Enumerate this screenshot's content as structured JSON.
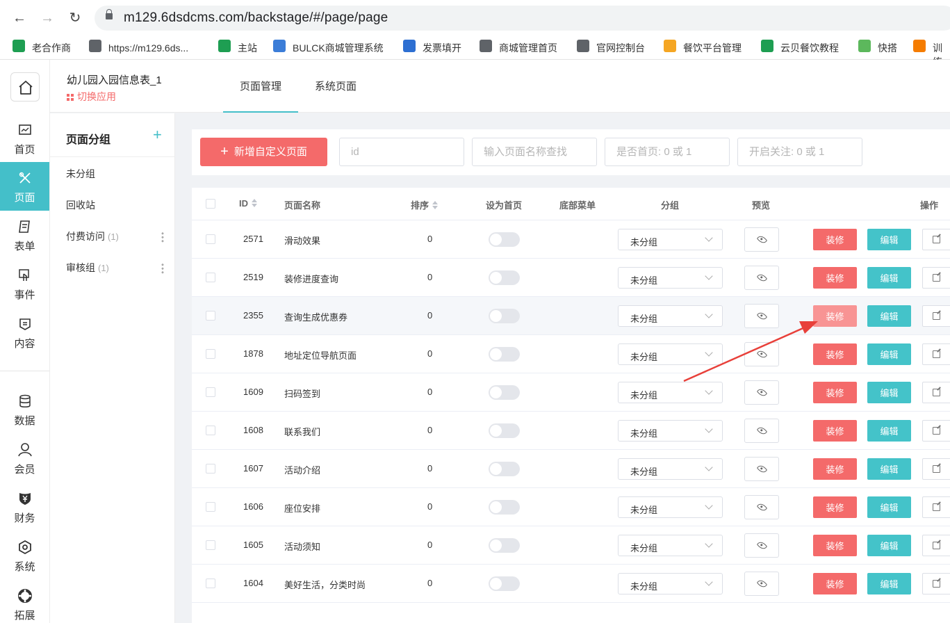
{
  "browser": {
    "url": "m129.6dsdcms.com/backstage/#/page/page",
    "bookmarks": [
      {
        "label": "老合作商",
        "icon_color": "#1e9e52"
      },
      {
        "label": "https://m129.6ds...",
        "icon_color": "#5f6368"
      },
      {
        "label": "主站",
        "icon_color": "#1e9e52"
      },
      {
        "label": "BULCK商城管理系统",
        "icon_color": "#3b7dd8"
      },
      {
        "label": "发票填开",
        "icon_color": "#2d6fd2"
      },
      {
        "label": "商城管理首页",
        "icon_color": "#5f6368"
      },
      {
        "label": "官网控制台",
        "icon_color": "#5f6368"
      },
      {
        "label": "餐饮平台管理",
        "icon_color": "#f5a623"
      },
      {
        "label": "云贝餐饮教程",
        "icon_color": "#1e9e52"
      },
      {
        "label": "快搭",
        "icon_color": "#5cb85c"
      },
      {
        "label": "训练",
        "icon_color": "#f57c00"
      }
    ]
  },
  "sidebar": {
    "items": [
      {
        "label": "首页",
        "icon": "chart-icon"
      },
      {
        "label": "页面",
        "icon": "design-tools-icon",
        "active": true
      },
      {
        "label": "表单",
        "icon": "form-icon"
      },
      {
        "label": "事件",
        "icon": "touch-icon"
      },
      {
        "label": "内容",
        "icon": "content-icon"
      },
      {
        "label": "数据",
        "icon": "database-icon"
      },
      {
        "label": "会员",
        "icon": "user-icon"
      },
      {
        "label": "财务",
        "icon": "yuan-icon"
      },
      {
        "label": "系统",
        "icon": "settings-icon"
      },
      {
        "label": "拓展",
        "icon": "extension-icon"
      }
    ]
  },
  "header": {
    "app_name": "幼儿园入园信息表_1",
    "switch_app": "切换应用",
    "tabs": [
      "页面管理",
      "系统页面"
    ]
  },
  "groups": {
    "title": "页面分组",
    "items": [
      {
        "label": "未分组",
        "count": ""
      },
      {
        "label": "回收站",
        "count": ""
      },
      {
        "label": "付费访问",
        "count": "(1)"
      },
      {
        "label": "审核组",
        "count": "(1)"
      }
    ]
  },
  "toolbar": {
    "add_label": "新增自定义页面",
    "id_placeholder": "id",
    "name_placeholder": "输入页面名称查找",
    "home_placeholder": "是否首页: 0 或 1",
    "follow_placeholder": "开启关注: 0 或 1"
  },
  "table": {
    "columns": {
      "id": "ID",
      "name": "页面名称",
      "sort": "排序",
      "homepage": "设为首页",
      "bottom_menu": "底部菜单",
      "group": "分组",
      "preview": "预览",
      "actions": "操作"
    },
    "decorate_label": "装修",
    "edit_label": "编辑",
    "rows": [
      {
        "id": "2571",
        "name": "滑动效果",
        "sort": "0",
        "group": "未分组"
      },
      {
        "id": "2519",
        "name": "装修进度查询",
        "sort": "0",
        "group": "未分组"
      },
      {
        "id": "2355",
        "name": "查询生成优惠券",
        "sort": "0",
        "group": "未分组"
      },
      {
        "id": "1878",
        "name": "地址定位导航页面",
        "sort": "0",
        "group": "未分组"
      },
      {
        "id": "1609",
        "name": "扫码签到",
        "sort": "0",
        "group": "未分组"
      },
      {
        "id": "1608",
        "name": "联系我们",
        "sort": "0",
        "group": "未分组"
      },
      {
        "id": "1607",
        "name": "活动介绍",
        "sort": "0",
        "group": "未分组"
      },
      {
        "id": "1606",
        "name": "座位安排",
        "sort": "0",
        "group": "未分组"
      },
      {
        "id": "1605",
        "name": "活动须知",
        "sort": "0",
        "group": "未分组"
      },
      {
        "id": "1604",
        "name": "美好生活，分类时尚",
        "sort": "0",
        "group": "未分组"
      }
    ]
  },
  "colors": {
    "accent": "#44bfc9",
    "primary_red": "#f46a6a",
    "annotation_arrow": "#e8403a"
  }
}
